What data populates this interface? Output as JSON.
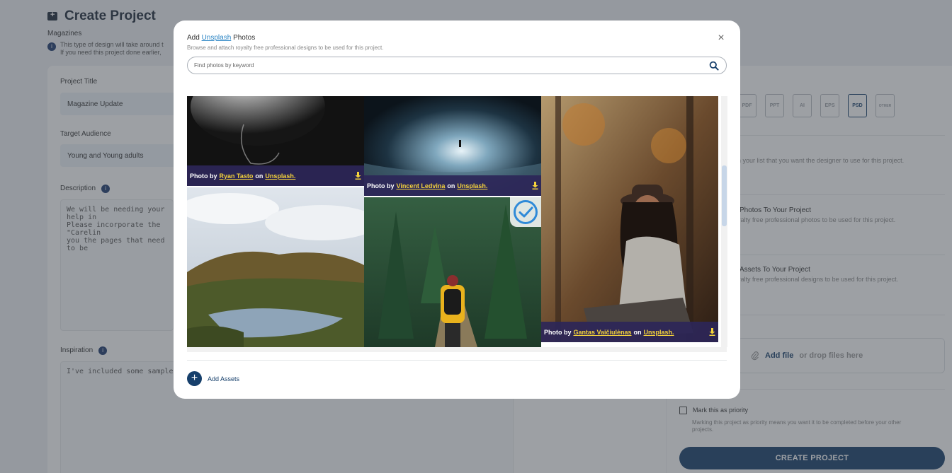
{
  "page": {
    "title": "Create Project",
    "subtitle": "Magazines",
    "info_line1": "This type of design will take around t",
    "info_line2": "If you need this project done earlier,"
  },
  "form": {
    "title_label": "Project Title",
    "title_value": "Magazine Update",
    "audience_label": "Target Audience",
    "audience_value": "Young and Young adults",
    "description_label": "Description",
    "description_lines": [
      "We will be needing your help in",
      "Please incorporate the \"Carelin",
      "you the pages that need to be"
    ],
    "inspiration_label": "Inspiration",
    "inspiration_text": "I've included some sample pict"
  },
  "right_panel": {
    "file_types": [
      "PDF",
      "PPT",
      "AI",
      "EPS",
      "PSD",
      "OTHER"
    ],
    "selected_file_type": "PSD",
    "fonts_hint": "n your list that you want the designer to use for this project.",
    "photos_heading": "Photos To Your Project",
    "photos_hint": "yalty free professional photos to be used for this project.",
    "assets_heading": "Assets To Your Project",
    "assets_hint": "yalty free professional designs to be used for this project.",
    "add_file": "Add file",
    "drop_files": "or drop files here",
    "priority_label": "Mark this as priority",
    "priority_hint_line1": "Marking this project as priority means you want it to be completed before your other",
    "priority_hint_line2": "projects.",
    "create_button": "CREATE PROJECT"
  },
  "modal": {
    "title_prefix": "Add",
    "title_link": "Unsplash",
    "title_suffix": "Photos",
    "subtitle": "Browse and attach royalty free professional designs to be used for this project.",
    "close_icon": "close-icon",
    "search_placeholder": "Find photos by keyword",
    "search_icon": "search-icon",
    "photos": [
      {
        "photographer": "Ryan Tasto",
        "scene": "dark water splash"
      },
      {
        "photographer": "Vincent Ledvina",
        "scene": "ice cave tunnel"
      },
      {
        "photographer": "Gantas Vaičiulėnas",
        "scene": "woman in forest"
      },
      {
        "photographer": "",
        "scene": "lake and hills landscape"
      },
      {
        "photographer": "",
        "scene": "hiker on forest path",
        "selected": true
      }
    ],
    "credit_prefix": "Photo by",
    "credit_on": "on",
    "credit_source": "Unsplash.",
    "add_assets_label": "Add Assets"
  }
}
